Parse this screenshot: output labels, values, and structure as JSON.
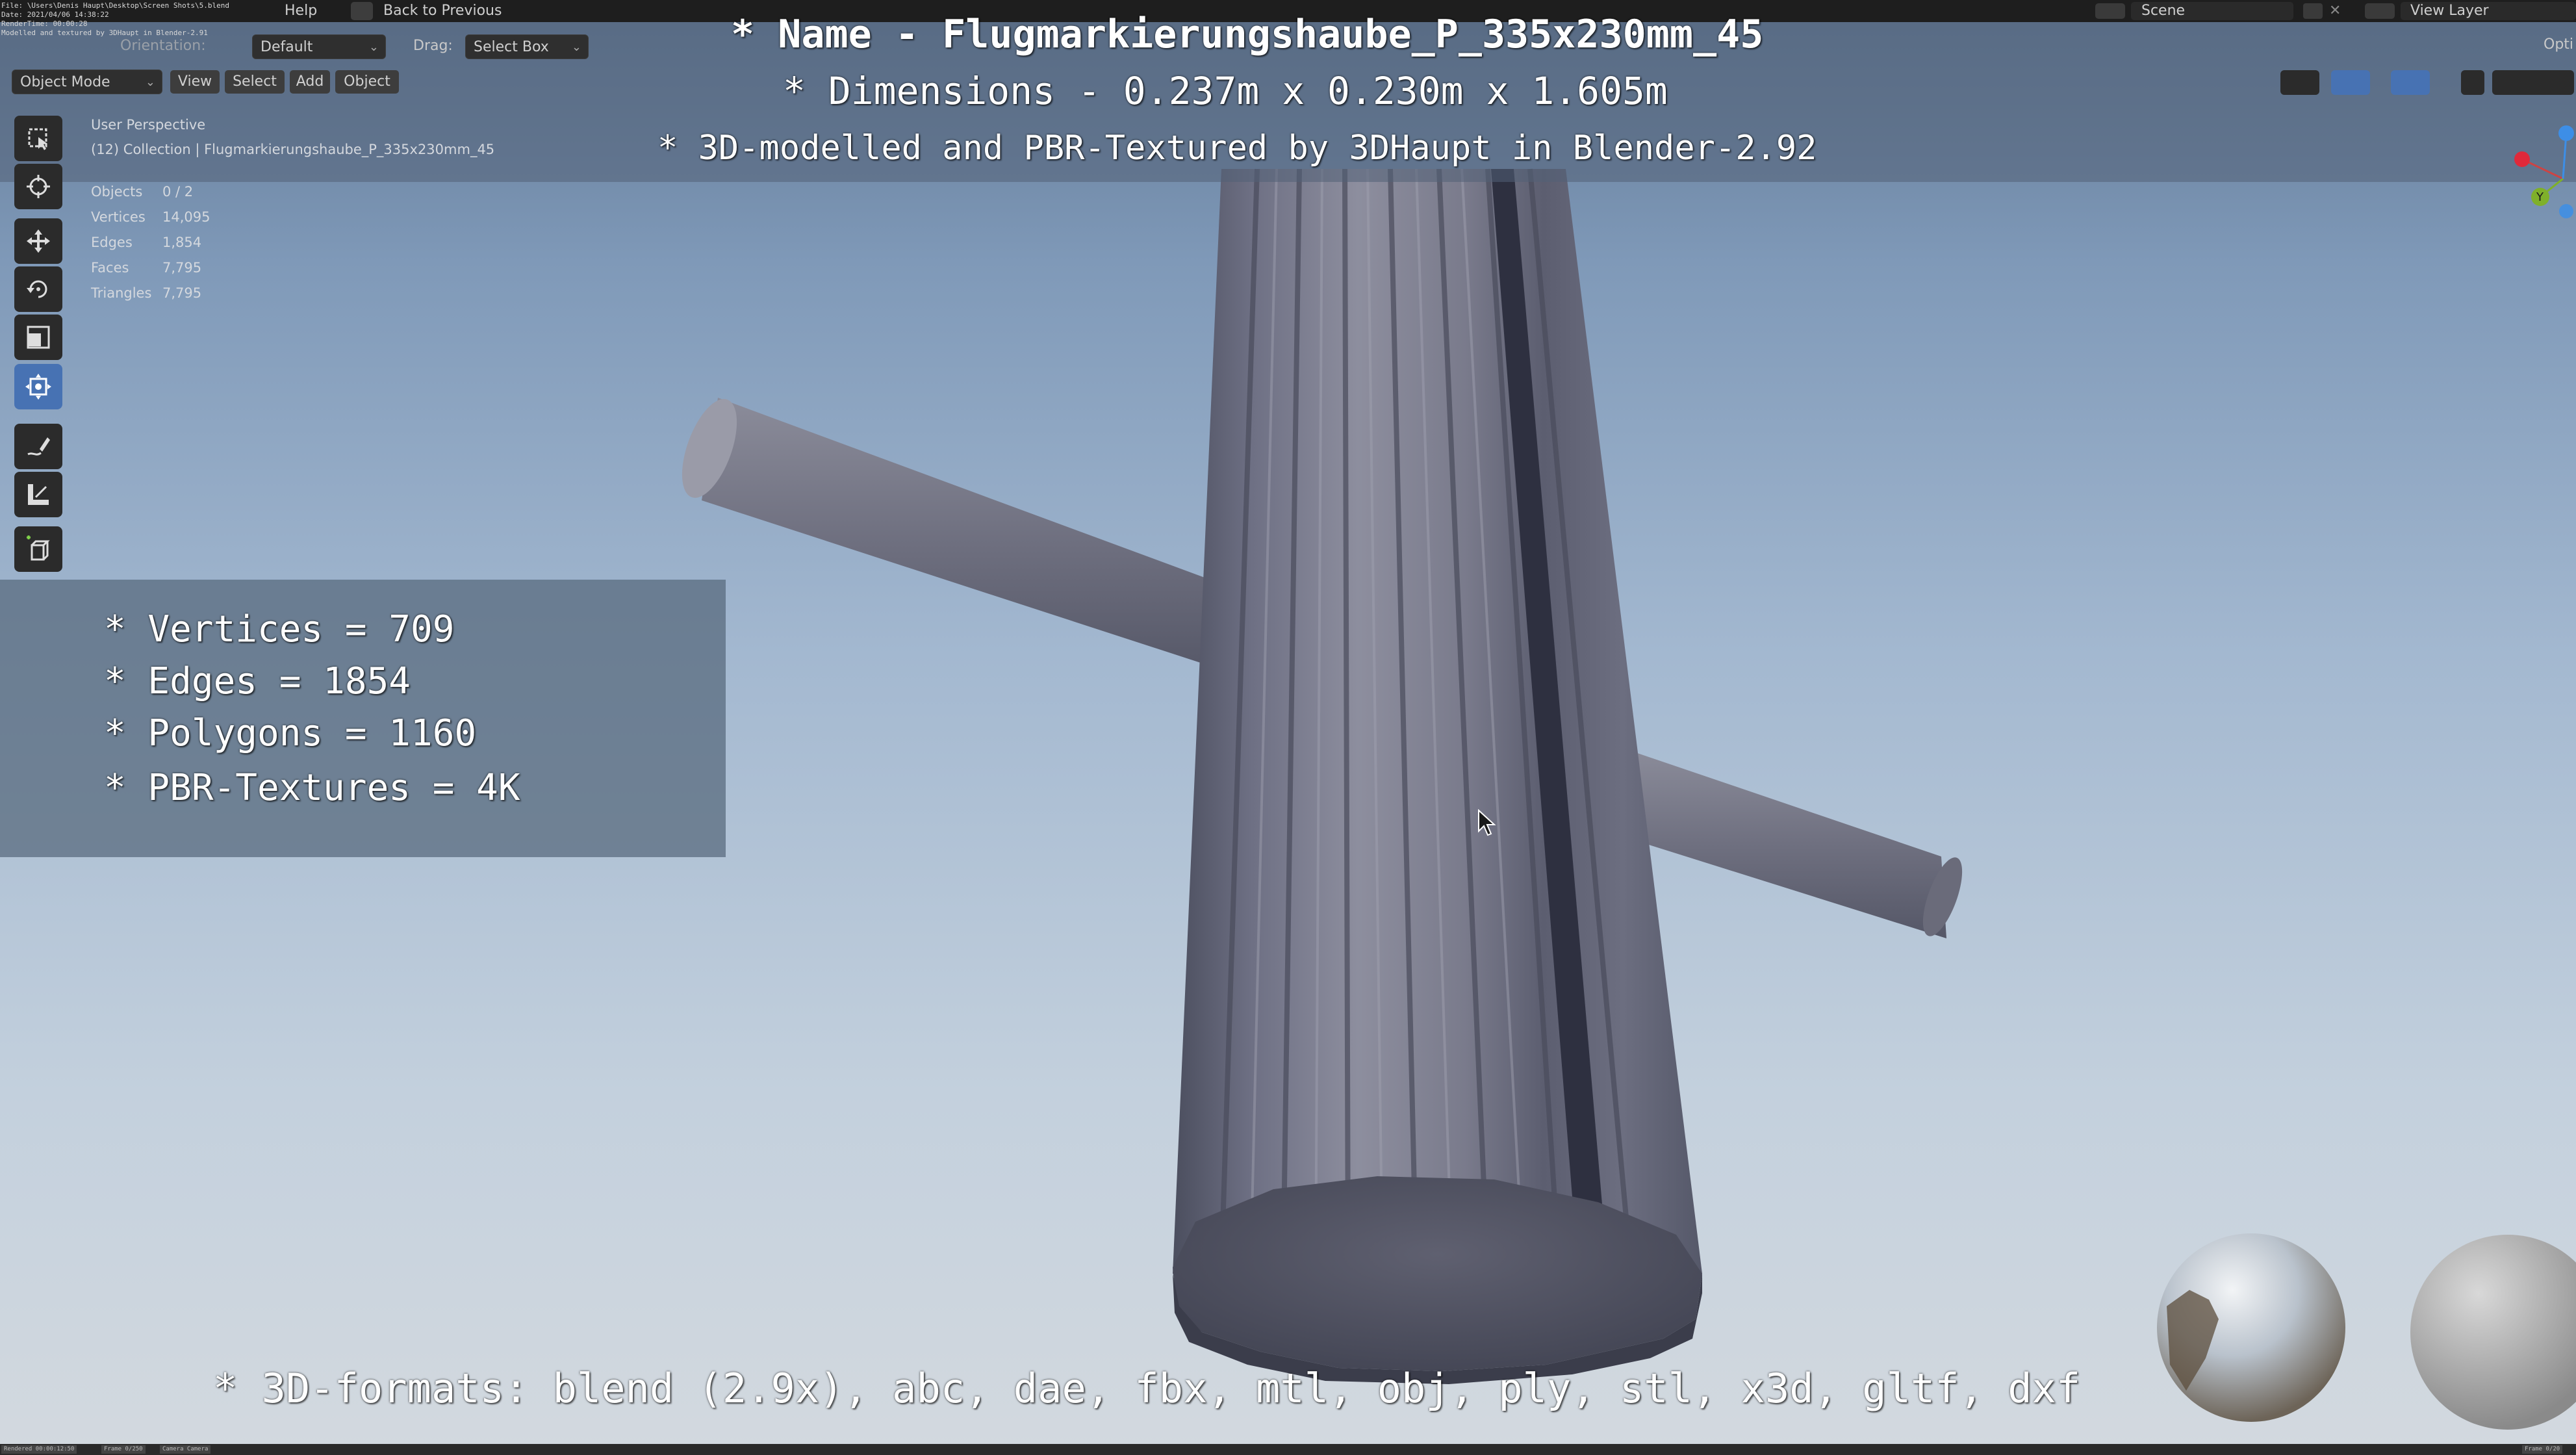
{
  "app": {
    "top_menu": {
      "help": "Help",
      "back": "Back to Previous",
      "scene": "Scene",
      "view_layer": "View Layer",
      "options": "Opti"
    },
    "render_info": [
      "File: \\Users\\Denis Haupt\\Desktop\\Screen Shots\\5.blend",
      "Date: 2021/04/06 14:38:22",
      "RenderTime: 00:00:28",
      "Modelled and textured by 3DHaupt in Blender-2.91"
    ],
    "header": {
      "orientation_label": "Orientation:",
      "orientation_value": "Default",
      "drag_label": "Drag:",
      "drag_value": "Select Box",
      "mode": "Object Mode",
      "menu_view": "View",
      "menu_select": "Select",
      "menu_add": "Add",
      "menu_object": "Object"
    },
    "viewport_info": {
      "perspective": "User Perspective",
      "collection": "(12) Collection | Flugmarkierungshaube_P_335x230mm_45"
    },
    "scene_stats": [
      {
        "label": "Objects",
        "value": "0 / 2"
      },
      {
        "label": "Vertices",
        "value": "14,095"
      },
      {
        "label": "Edges",
        "value": "1,854"
      },
      {
        "label": "Faces",
        "value": "7,795"
      },
      {
        "label": "Triangles",
        "value": "7,795"
      }
    ],
    "toolbar": [
      "select-box-icon",
      "cursor-icon",
      "move-icon",
      "rotate-icon",
      "scale-icon",
      "transform-icon",
      "annotate-icon",
      "measure-icon",
      "add-cube-icon"
    ],
    "status_chips": [
      "Rendered 00:00:12:50",
      "Frame 0/250",
      "Camera Camera"
    ],
    "status_right": "Frame 0/20"
  },
  "overlay": {
    "name": "* Name - Flugmarkierungshaube_P_335x230mm_45",
    "dimensions": "* Dimensions -  0.237m x 0.230m x 1.605m",
    "credit": "* 3D-modelled and PBR-Textured by 3DHaupt in Blender-2.92",
    "stats": [
      "* Vertices = 709",
      "* Edges = 1854",
      "* Polygons = 1160",
      "* PBR-Textures = 4K"
    ],
    "formats": "* 3D-formats: blend (2.9x), abc, dae, fbx, mtl, obj, ply, stl, x3d, gltf, dxf"
  },
  "gizmo": {
    "axis_y": "Y"
  },
  "colors": {
    "accent": "#4772b3",
    "object": "#6e6f7e",
    "axis_x": "#e0293a",
    "axis_y": "#7fb02a",
    "axis_z": "#3d8ee6"
  }
}
